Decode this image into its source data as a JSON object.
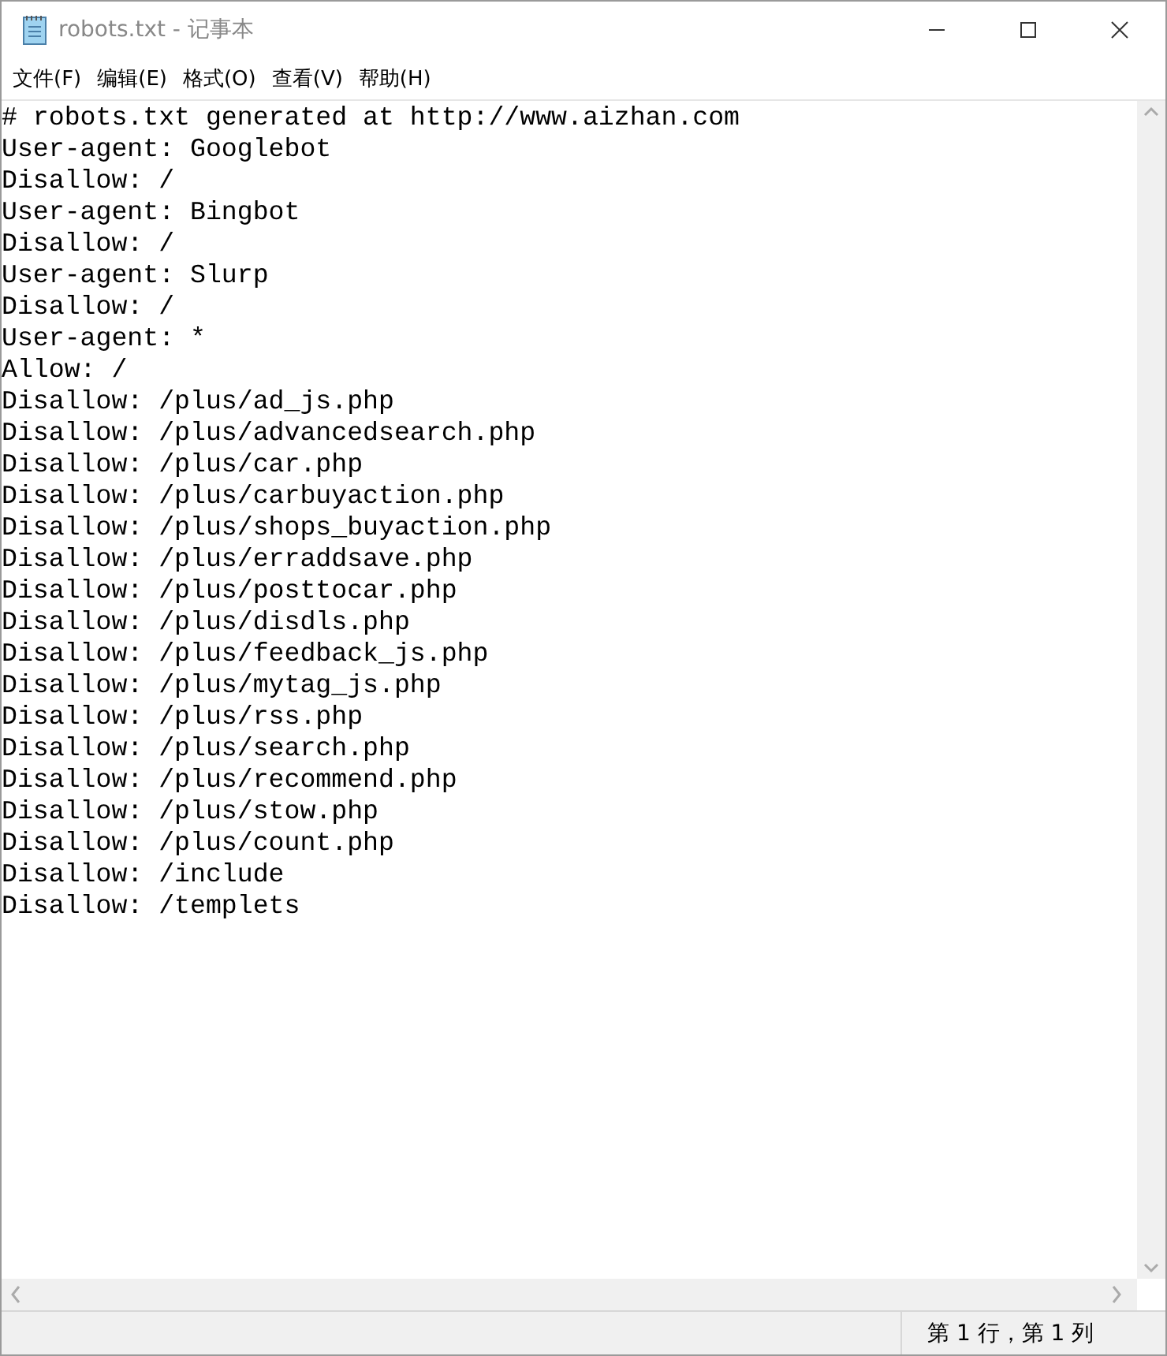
{
  "window": {
    "title": "robots.txt - 记事本"
  },
  "menu": [
    "文件(F)",
    "编辑(E)",
    "格式(O)",
    "查看(V)",
    "帮助(H)"
  ],
  "lines": [
    "# robots.txt generated at http://www.aizhan.com",
    "User-agent: Googlebot",
    "Disallow: /",
    "User-agent: Bingbot",
    "Disallow: /",
    "User-agent: Slurp",
    "Disallow: /",
    "User-agent: *",
    "Allow: /",
    "Disallow: /plus/ad_js.php",
    "Disallow: /plus/advancedsearch.php",
    "Disallow: /plus/car.php",
    "Disallow: /plus/carbuyaction.php",
    "Disallow: /plus/shops_buyaction.php",
    "Disallow: /plus/erraddsave.php",
    "Disallow: /plus/posttocar.php",
    "Disallow: /plus/disdls.php",
    "Disallow: /plus/feedback_js.php",
    "Disallow: /plus/mytag_js.php",
    "Disallow: /plus/rss.php",
    "Disallow: /plus/search.php",
    "Disallow: /plus/recommend.php",
    "Disallow: /plus/stow.php",
    "Disallow: /plus/count.php",
    "Disallow: /include",
    "Disallow: /templets"
  ],
  "status_bar": {
    "position": "第 1 行，第 1 列"
  }
}
